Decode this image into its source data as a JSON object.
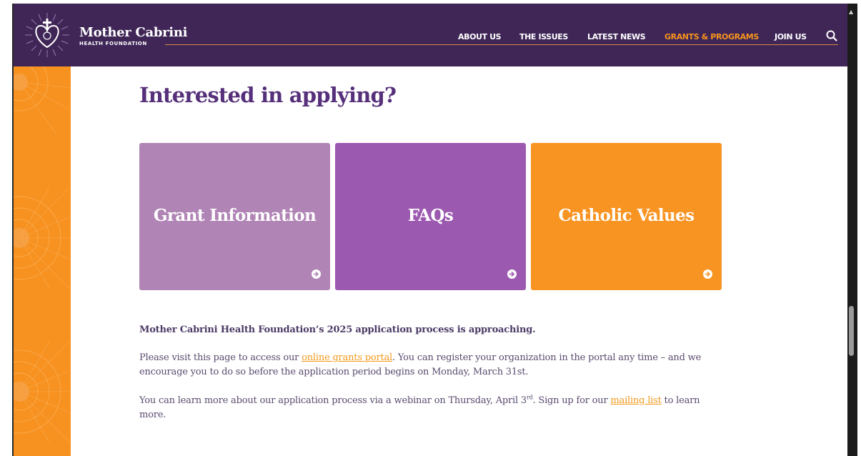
{
  "header": {
    "brand_name": "Mother Cabrini",
    "brand_sub": "HEALTH FOUNDATION",
    "nav": [
      {
        "label": "ABOUT US"
      },
      {
        "label": "THE ISSUES"
      },
      {
        "label": "LATEST NEWS"
      },
      {
        "label": "GRANTS & PROGRAMS"
      },
      {
        "label": "JOIN US"
      }
    ],
    "search_icon": "search-icon"
  },
  "main": {
    "title": "Interested in applying?",
    "cards": [
      {
        "label": "Grant Information",
        "color": "#b084b5",
        "icon": "arrow-right-circle-icon"
      },
      {
        "label": "FAQs",
        "color": "#9b59b0",
        "icon": "arrow-right-circle-icon"
      },
      {
        "label": "Catholic Values",
        "color": "#f89422",
        "icon": "arrow-right-circle-icon"
      }
    ],
    "announcement": "Mother Cabrini Health Foundation’s 2025 application process is approaching.",
    "para1": {
      "before": "Please visit this page to access our ",
      "link": "online grants portal",
      "after": ". You can register your organization in the portal any time – and we encourage you to do so before the application period begins on Monday, March 31st."
    },
    "para2": {
      "before": "You can learn more about our application process via a webinar on Thursday, April 3",
      "sup": "rd",
      "middle": ". Sign up for our ",
      "link": "mailing list",
      "after": " to learn more."
    }
  },
  "colors": {
    "header_bg": "#3f2657",
    "accent_orange": "#f7941d",
    "title_purple": "#56307a"
  }
}
